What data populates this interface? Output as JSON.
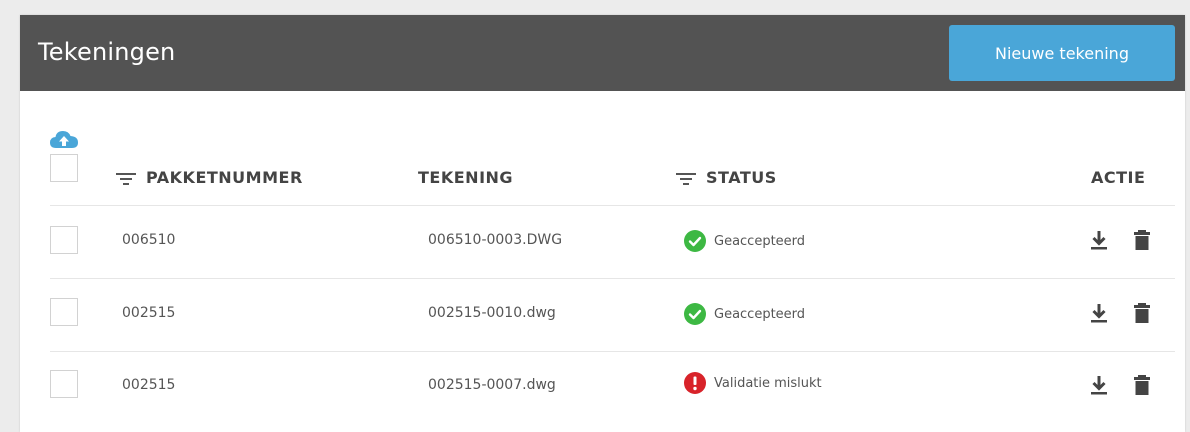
{
  "header": {
    "title": "Tekeningen",
    "new_button_label": "Nieuwe tekening"
  },
  "table": {
    "columns": {
      "pakketnummer": "PAKKETNUMMER",
      "tekening": "TEKENING",
      "status": "STATUS",
      "actie": "ACTIE"
    },
    "rows": [
      {
        "pakketnummer": "006510",
        "tekening": "006510-0003.DWG",
        "status": "Geaccepteerd",
        "status_type": "success"
      },
      {
        "pakketnummer": "002515",
        "tekening": "002515-0010.dwg",
        "status": "Geaccepteerd",
        "status_type": "success"
      },
      {
        "pakketnummer": "002515",
        "tekening": "002515-0007.dwg",
        "status": "Validatie mislukt",
        "status_type": "error"
      }
    ]
  },
  "icons": {
    "upload": "cloud-upload-icon",
    "filter": "filter-icon",
    "success": "check-circle-icon",
    "error": "exclamation-circle-icon",
    "download": "download-icon",
    "delete": "trash-icon"
  },
  "colors": {
    "header_bg": "#535353",
    "accent": "#4aa6d8",
    "success": "#3db843",
    "error": "#d8232a"
  }
}
